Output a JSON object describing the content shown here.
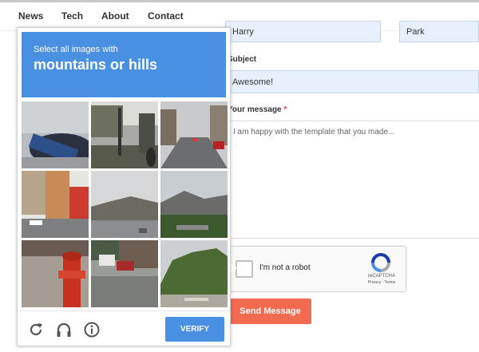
{
  "nav": {
    "items": [
      "News",
      "Tech",
      "About",
      "Contact"
    ]
  },
  "form": {
    "first_name_value": "Harry",
    "last_name_value": "Park",
    "subject_label": "Subject",
    "subject_value": "Awesome!",
    "message_label": "Your message",
    "message_required": "*",
    "message_value": "I am happy with the template that you made...",
    "send_label": "Send Message"
  },
  "recaptcha": {
    "checkbox_label": "I'm not a robot",
    "brand": "reCAPTCHA",
    "links": "Privacy - Terms"
  },
  "challenge": {
    "instruction": "Select all images with",
    "target": "mountains or hills",
    "verify_label": "VERIFY",
    "accent": "#4a90e2",
    "tiles": [
      "close-up-car-tile",
      "street-with-pole-tile",
      "city-road-tile",
      "building-facade-tile",
      "hill-landscape-tile",
      "mountain-trees-tile",
      "fire-hydrant-tile",
      "street-cars-tile",
      "forest-hillside-tile"
    ],
    "icons": [
      "reload-icon",
      "headphones-icon",
      "info-icon"
    ]
  },
  "colors": {
    "send_button": "#f26a4f",
    "input_bg": "#e8f0fe"
  }
}
